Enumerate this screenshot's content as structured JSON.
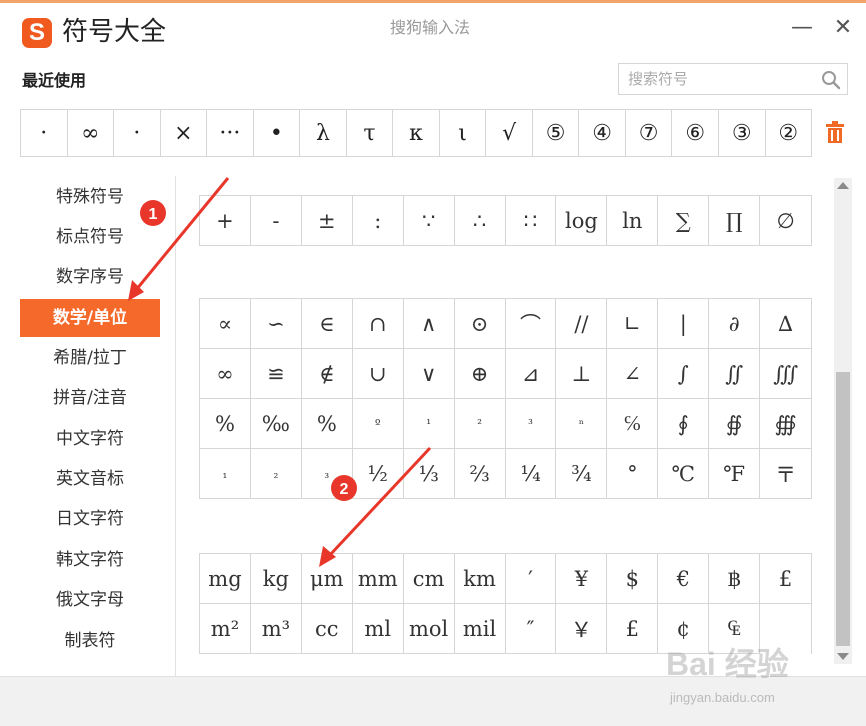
{
  "window": {
    "logo_letter": "S",
    "app_title": "符号大全",
    "ime_title": "搜狗输入法",
    "minimize_glyph": "—",
    "close_glyph": "✕"
  },
  "recent": {
    "label": "最近使用",
    "symbols": [
      "·",
      "∞",
      "·",
      "×",
      "···",
      "•",
      "λ",
      "τ",
      "κ",
      "ι",
      "√",
      "⑤",
      "④",
      "⑦",
      "⑥",
      "③",
      "②"
    ],
    "clear_icon": "trash-icon"
  },
  "search": {
    "placeholder": "搜索符号",
    "value": "",
    "icon": "search-icon"
  },
  "sidebar": {
    "items": [
      {
        "label": "特殊符号",
        "active": false
      },
      {
        "label": "标点符号",
        "active": false
      },
      {
        "label": "数字序号",
        "active": false
      },
      {
        "label": "数学/单位",
        "active": true
      },
      {
        "label": "希腊/拉丁",
        "active": false
      },
      {
        "label": "拼音/注音",
        "active": false
      },
      {
        "label": "中文字符",
        "active": false
      },
      {
        "label": "英文音标",
        "active": false
      },
      {
        "label": "日文字符",
        "active": false
      },
      {
        "label": "韩文字符",
        "active": false
      },
      {
        "label": "俄文字母",
        "active": false
      },
      {
        "label": "制表符",
        "active": false
      }
    ]
  },
  "groups": [
    {
      "rows": [
        [
          "+",
          "-",
          "±",
          ":",
          "∵",
          "∴",
          "∷",
          "log",
          "ln",
          "∑",
          "∏",
          "∅"
        ]
      ]
    },
    {
      "rows": [
        [
          "∝",
          "∽",
          "∈",
          "∩",
          "∧",
          "⊙",
          "⌒",
          "//",
          "∟",
          "|",
          "∂",
          "∆"
        ],
        [
          "∞",
          "≌",
          "∉",
          "∪",
          "∨",
          "⊕",
          "⊿",
          "⊥",
          "∠",
          "∫",
          "∬",
          "∭"
        ],
        [
          "%",
          "‰",
          "%",
          "º",
          "¹",
          "²",
          "³",
          "ⁿ",
          "℅",
          "∮",
          "∯",
          "∰"
        ],
        [
          "₁",
          "₂",
          "₃",
          "½",
          "⅓",
          "⅔",
          "¼",
          "¾",
          "°",
          "℃",
          "℉",
          "〒"
        ]
      ]
    },
    {
      "rows": [
        [
          "mg",
          "kg",
          "μm",
          "mm",
          "cm",
          "km",
          "′",
          "¥",
          "$",
          "€",
          "฿",
          "£"
        ],
        [
          "m²",
          "m³",
          "cc",
          "ml",
          "mol",
          "mil",
          "″",
          "￥",
          "£",
          "¢",
          "₠",
          ""
        ]
      ]
    }
  ],
  "annotations": [
    {
      "label": "1"
    },
    {
      "label": "2"
    }
  ],
  "colors": {
    "accent": "#f56a2b",
    "annotation_red": "#e8372a",
    "logo": "#f05a1e"
  },
  "watermark": {
    "brand": "Bai  经验",
    "url": "jingyan.baidu.com"
  }
}
